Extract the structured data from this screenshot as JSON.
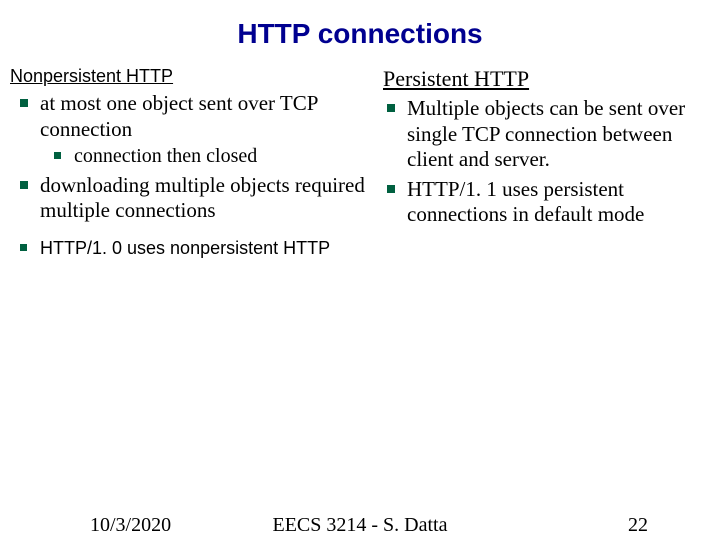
{
  "title": "HTTP connections",
  "left": {
    "heading": "Nonpersistent HTTP",
    "items": [
      {
        "text": "at most one object sent over TCP connection",
        "sub": [
          "connection then closed"
        ]
      },
      {
        "text": "downloading multiple objects required multiple connections"
      }
    ],
    "note": "HTTP/1. 0 uses nonpersistent HTTP"
  },
  "right": {
    "heading": "Persistent HTTP",
    "items": [
      {
        "text": "Multiple objects can be sent over single TCP connection between client and server."
      },
      {
        "text": "HTTP/1. 1 uses persistent connections in default mode"
      }
    ]
  },
  "footer": {
    "date": "10/3/2020",
    "center": "EECS 3214 - S. Datta",
    "page": "22"
  }
}
